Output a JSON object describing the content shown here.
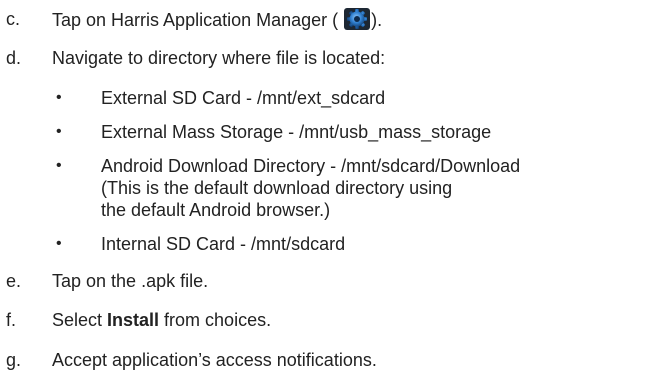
{
  "steps": [
    {
      "marker": "c.",
      "before": "Tap on Harris Application Manager (",
      "icon": "gear-app-icon",
      "after": ")."
    },
    {
      "marker": "d.",
      "text": "Navigate to directory where file is located:",
      "items": [
        {
          "lines": [
            "External SD Card - /mnt/ext_sdcard"
          ]
        },
        {
          "lines": [
            "External Mass Storage - /mnt/usb_mass_storage"
          ]
        },
        {
          "lines": [
            "Android Download Directory - /mnt/sdcard/Download",
            "(This is the default download directory using",
            "the default Android browser.)"
          ]
        },
        {
          "lines": [
            "Internal SD Card - /mnt/sdcard"
          ]
        }
      ]
    },
    {
      "marker": "e.",
      "text": "Tap on the .apk file."
    },
    {
      "marker": "f.",
      "before": "Select ",
      "bold": "Install",
      "after": " from choices."
    },
    {
      "marker": "g.",
      "text": "Accept application’s access notifications."
    }
  ],
  "bullet_glyph": "•",
  "colors": {
    "text": "#222222",
    "icon_blue": "#2f7fd0",
    "icon_dark": "#123e73"
  }
}
